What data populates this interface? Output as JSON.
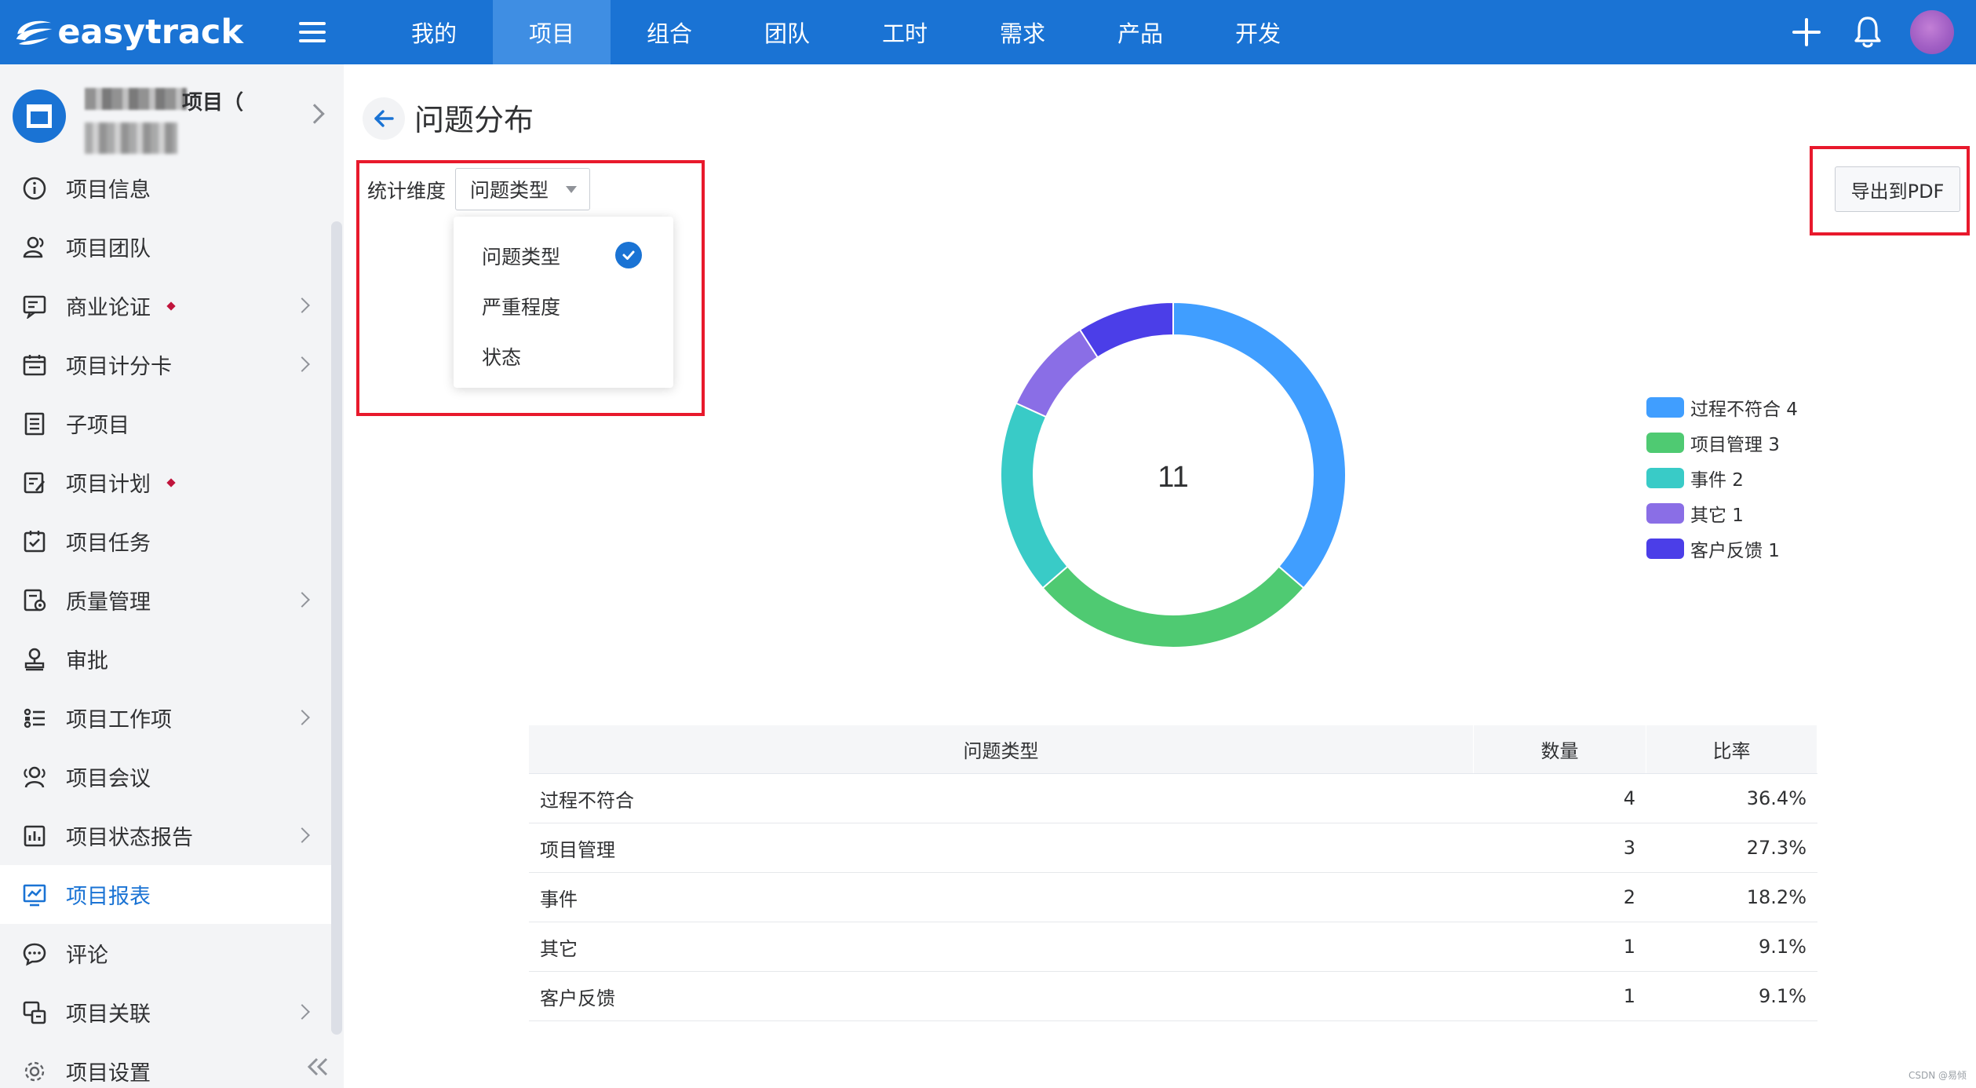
{
  "app": {
    "logo_text": "easytrack"
  },
  "nav": {
    "items": [
      "我的",
      "项目",
      "组合",
      "团队",
      "工时",
      "需求",
      "产品",
      "开发"
    ],
    "active_index": 1
  },
  "sidebar": {
    "project_name_suffix": "项目（",
    "items": [
      {
        "label": "项目信息",
        "icon": "info-icon",
        "chevron": false,
        "dot": false
      },
      {
        "label": "项目团队",
        "icon": "team-icon",
        "chevron": false,
        "dot": false
      },
      {
        "label": "商业论证",
        "icon": "business-case-icon",
        "chevron": true,
        "dot": true
      },
      {
        "label": "项目计分卡",
        "icon": "scorecard-icon",
        "chevron": true,
        "dot": false
      },
      {
        "label": "子项目",
        "icon": "subproject-icon",
        "chevron": false,
        "dot": false
      },
      {
        "label": "项目计划",
        "icon": "plan-icon",
        "chevron": false,
        "dot": true
      },
      {
        "label": "项目任务",
        "icon": "task-icon",
        "chevron": false,
        "dot": false
      },
      {
        "label": "质量管理",
        "icon": "quality-icon",
        "chevron": true,
        "dot": false
      },
      {
        "label": "审批",
        "icon": "approval-stamp-icon",
        "chevron": false,
        "dot": false
      },
      {
        "label": "项目工作项",
        "icon": "work-item-icon",
        "chevron": true,
        "dot": false
      },
      {
        "label": "项目会议",
        "icon": "meeting-icon",
        "chevron": false,
        "dot": false
      },
      {
        "label": "项目状态报告",
        "icon": "status-report-icon",
        "chevron": true,
        "dot": false
      },
      {
        "label": "项目报表",
        "icon": "report-chart-icon",
        "chevron": false,
        "dot": false,
        "active": true
      },
      {
        "label": "评论",
        "icon": "comment-icon",
        "chevron": false,
        "dot": false
      },
      {
        "label": "项目关联",
        "icon": "link-icon",
        "chevron": true,
        "dot": false
      },
      {
        "label": "项目设置",
        "icon": "settings-gear-icon",
        "chevron": false,
        "dot": false
      }
    ]
  },
  "page": {
    "title": "问题分布",
    "dimension_label": "统计维度",
    "dimension_value": "问题类型",
    "dropdown_options": [
      "问题类型",
      "严重程度",
      "状态"
    ],
    "dropdown_selected_index": 0,
    "export_label": "导出到PDF"
  },
  "chart_data": {
    "type": "pie",
    "donut": true,
    "center_label": "11",
    "categories": [
      "过程不符合",
      "项目管理",
      "事件",
      "其它",
      "客户反馈"
    ],
    "values": [
      4,
      3,
      2,
      1,
      1
    ],
    "colors": [
      "#409eff",
      "#4fca72",
      "#39cbc7",
      "#8a6ee6",
      "#4b3ee8"
    ],
    "legend": [
      "过程不符合 4",
      "项目管理 3",
      "事件 2",
      "其它 1",
      "客户反馈 1"
    ],
    "legend_position": "right"
  },
  "table": {
    "headers": [
      "问题类型",
      "数量",
      "比率"
    ],
    "rows": [
      [
        "过程不符合",
        "4",
        "36.4%"
      ],
      [
        "项目管理",
        "3",
        "27.3%"
      ],
      [
        "事件",
        "2",
        "18.2%"
      ],
      [
        "其它",
        "1",
        "9.1%"
      ],
      [
        "客户反馈",
        "1",
        "9.1%"
      ]
    ]
  },
  "footer": {
    "watermark": "CSDN @易倾"
  }
}
